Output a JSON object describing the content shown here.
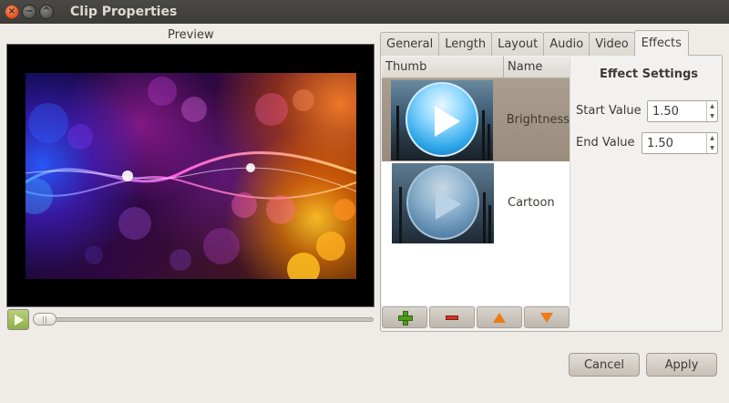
{
  "window": {
    "title": "Clip Properties",
    "close_glyph": "×",
    "minimize_glyph": "−",
    "maximize_glyph": "^"
  },
  "preview": {
    "label": "Preview",
    "handle_glyph": "||"
  },
  "tabs": [
    {
      "label": "General"
    },
    {
      "label": "Length"
    },
    {
      "label": "Layout"
    },
    {
      "label": "Audio"
    },
    {
      "label": "Video"
    },
    {
      "label": "Effects",
      "active": true
    }
  ],
  "effects_list": {
    "columns": {
      "thumb": "Thumb",
      "name": "Name"
    },
    "items": [
      {
        "name": "Brightness",
        "selected": true
      },
      {
        "name": "Cartoon",
        "selected": false
      }
    ]
  },
  "effect_settings": {
    "title": "Effect Settings",
    "start_label": "Start Value",
    "start_value": "1.50",
    "end_label": "End Value",
    "end_value": "1.50",
    "spin_up": "▲",
    "spin_down": "▼"
  },
  "buttons": {
    "cancel": "Cancel",
    "apply": "Apply"
  },
  "colors": {
    "titlebar": "#3c3b37",
    "selection": "#a09484",
    "window_bg": "#efebe7"
  }
}
